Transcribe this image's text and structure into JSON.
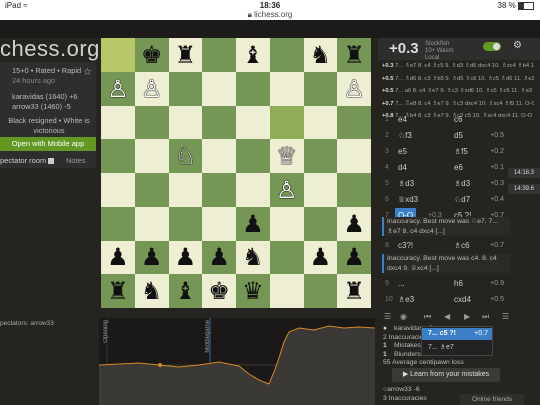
{
  "status_bar": {
    "left": "iPad ≈",
    "time": "18:36",
    "url": "lichess.org",
    "battery": "38 %",
    "battery_level": 0.38
  },
  "site": {
    "logo": "chess.org"
  },
  "game_info": {
    "type_line": "15+0 • Rated • Rapid",
    "time_ago": "24 hours ago",
    "white_player": "karavidas (1640) +6",
    "black_player": "arrow33 (1460) -5",
    "result": "Black resigned • White is victorious",
    "mobile_button": "Open with Mobile app"
  },
  "chat": {
    "spectator_label": "pectator room",
    "notes_tab": "Notes",
    "spectators": "pectators: arrow33"
  },
  "board": {
    "rows": [
      [
        "",
        "bk",
        "br",
        "",
        "bb",
        "",
        "bn",
        "br"
      ],
      [
        "wp",
        "wp",
        "",
        "",
        "",
        "",
        "",
        "wp"
      ],
      [
        "",
        "",
        "",
        "",
        "",
        "",
        "",
        ""
      ],
      [
        "",
        "",
        "wn",
        "",
        "",
        "wq",
        "",
        ""
      ],
      [
        "",
        "",
        "",
        "",
        "",
        "wp",
        "",
        ""
      ],
      [
        "",
        "",
        "",
        "",
        "bp",
        "",
        "",
        "bp"
      ],
      [
        "",
        "",
        "",
        "",
        "bp",
        "",
        "",
        ""
      ],
      [
        "",
        "",
        "",
        "",
        "",
        "",
        "",
        ""
      ]
    ],
    "rows_low": [
      [
        "bp",
        "bp",
        "bp",
        "bp",
        "bn",
        "",
        "bp",
        "bp"
      ],
      [
        "br",
        "bn",
        "bb",
        "bk",
        "bk2",
        "",
        "",
        "br"
      ]
    ],
    "pieces": {
      "bk": "♚",
      "br": "♜",
      "bb": "♝",
      "bn": "♞",
      "bp": "♟",
      "bq": "♛",
      "bk2": "♛",
      "wk": "♔",
      "wr": "♖",
      "wb": "♗",
      "wn": "♘",
      "wp": "♙",
      "wq": "♕"
    }
  },
  "graph": {
    "label_opening": "Opening",
    "label_middlegame": "Middlegame"
  },
  "analysis": {
    "eval": "+0.3",
    "engine_name": "Stockfish",
    "engine_depth": "10+ Wasm",
    "engine_local": "Local",
    "pvs": [
      {
        "ev": "+0.3",
        "line": "7... ♗e7 8. c4 ♗c5 9. ♗d3 ♗d6 dxc4 10. ♗xc4 ♗b4 11. O-O"
      },
      {
        "ev": "+0.5",
        "line": "7... ♗d6 8. c3 ♗b5 9. ♗d5 ♗c6 10. ♗c5 ♗d6 11. ♗e3"
      },
      {
        "ev": "+0.5",
        "line": "7... a6 8. c4 ♗e7 9. ♗c3 ♗xd6 10. ♗c5 ♗c6 11. ♗e3"
      },
      {
        "ev": "+0.7",
        "line": "7... ♖e8 8. c4 ♗e7 9. ♗c3 dxc4 10. ♗xc4 ♗f5 11. O-O"
      },
      {
        "ev": "+0.8",
        "line": "7... ♗b4 8. c3 ♗e7 9. ♗c2 c5 10. ♗xc4 dxc4 11. O-O"
      }
    ],
    "moves": [
      {
        "n": "1",
        "w": "e4",
        "b": "c6",
        "ev": ""
      },
      {
        "n": "2",
        "w": "♘f3",
        "b": "d5",
        "ev": "+0.5"
      },
      {
        "n": "3",
        "w": "e5",
        "b": "♗f5",
        "ev": "+0.2"
      },
      {
        "n": "4",
        "w": "d4",
        "b": "e6",
        "ev": "+0.1"
      },
      {
        "n": "5",
        "w": "♗d3",
        "b": "♗d3",
        "ev": "+0.3"
      },
      {
        "n": "6",
        "w": "♕xd3",
        "b": "♘d7",
        "ev": "+0.4"
      },
      {
        "n": "7",
        "w": "O-O",
        "b": "c5 ?!",
        "ev": "+0.7",
        "mid": "+0.3"
      }
    ],
    "comment1": "Inaccuracy. Best move was ♘e7. 7... ♗e7 8. c4 dxc4 [...]",
    "moves_after": [
      {
        "n": "8",
        "w": "c3?!",
        "b": "♗c6",
        "ev": "+0.7"
      }
    ],
    "comment2": "Inaccuracy. Best move was c4. 8. c4 dxc4 9. ♕xc4 [...]",
    "moves_late": [
      {
        "n": "9",
        "w": "...",
        "b": "h6",
        "ev": "+0.9"
      },
      {
        "n": "10",
        "w": "♗e3",
        "b": "cxd4",
        "ev": "+0.5"
      }
    ],
    "ticker1": "14:18.3",
    "ticker2": "14:39.6",
    "popup_selected": "7... c5 ?!",
    "popup_selected_ev": "+0.7",
    "popup_other": "7... ♗e7",
    "white_summary": {
      "name": "karavidas +6",
      "inaccuracies": "2 Inaccuracies",
      "mistakes": "Mistakes",
      "blunders": "Blunders",
      "acpl": "55 Average centipawn loss"
    },
    "learn_button": "Learn from your mistakes",
    "black_summary": {
      "name": "arrow33 -6",
      "inaccuracies": "3 Inaccuracies",
      "mistakes": "Mistakes"
    },
    "online_friends": "Online friends"
  }
}
